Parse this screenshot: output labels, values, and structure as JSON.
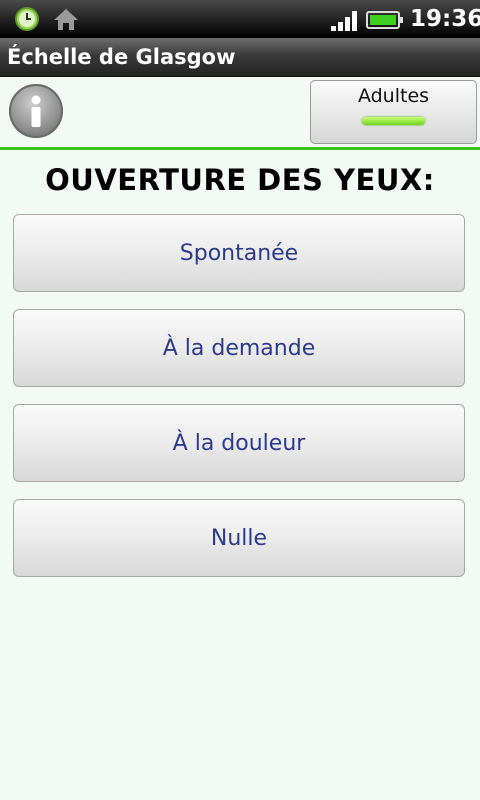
{
  "status_bar": {
    "time": "19:36",
    "icons": [
      "clock-notification-icon",
      "home-icon",
      "signal-icon",
      "battery-icon"
    ],
    "battery_color": "#3fcf1f"
  },
  "app_bar": {
    "title": "Échelle de Glasgow"
  },
  "toolbar": {
    "info_icon": "info-icon",
    "mode_toggle": {
      "label": "Adultes",
      "active": true,
      "indicator_color": "#6fd21b"
    }
  },
  "main": {
    "question": "OUVERTURE DES YEUX:",
    "options": [
      {
        "label": "Spontanée"
      },
      {
        "label": "À la demande"
      },
      {
        "label": "À la douleur"
      },
      {
        "label": "Nulle"
      }
    ],
    "option_text_color": "#2b3a8c",
    "accent_rule_color": "#3cc41e"
  }
}
